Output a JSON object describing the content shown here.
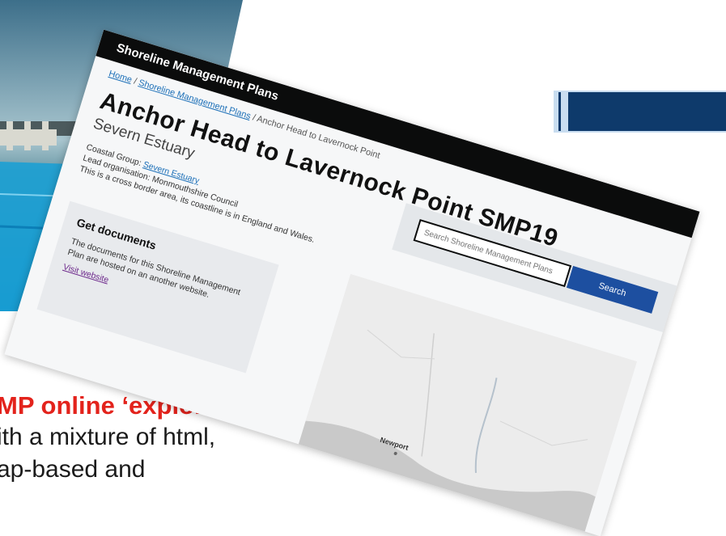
{
  "slide": {
    "caption_line1": "MP online ‘explorer’",
    "caption_line2": "ith a mixture of html,",
    "caption_line3": "ap-based and"
  },
  "site": {
    "header_title": "Shoreline Management Plans",
    "breadcrumb": {
      "home": "Home",
      "sep1": " / ",
      "plans": "Shoreline Management Plans",
      "sep2": " / ",
      "current": "Anchor Head to Lavernock Point"
    },
    "page_title": "Anchor Head to Lavernock Point SMP19",
    "subtitle": "Severn Estuary",
    "meta": {
      "coastal_group_label": "Coastal Group: ",
      "coastal_group_value": "Severn Estuary",
      "lead_org": "Lead organisation: Monmouthshire Council",
      "cross_border": "This is a cross border area, its coastline is in England and Wales."
    },
    "search": {
      "placeholder": "Search Shoreline Management Plans",
      "button": "Search"
    },
    "documents": {
      "title": "Get documents",
      "text": "The documents for this Shoreline Management Plan are hosted on an another website.",
      "link": "Visit website"
    },
    "map": {
      "label_newport": "Newport"
    }
  }
}
